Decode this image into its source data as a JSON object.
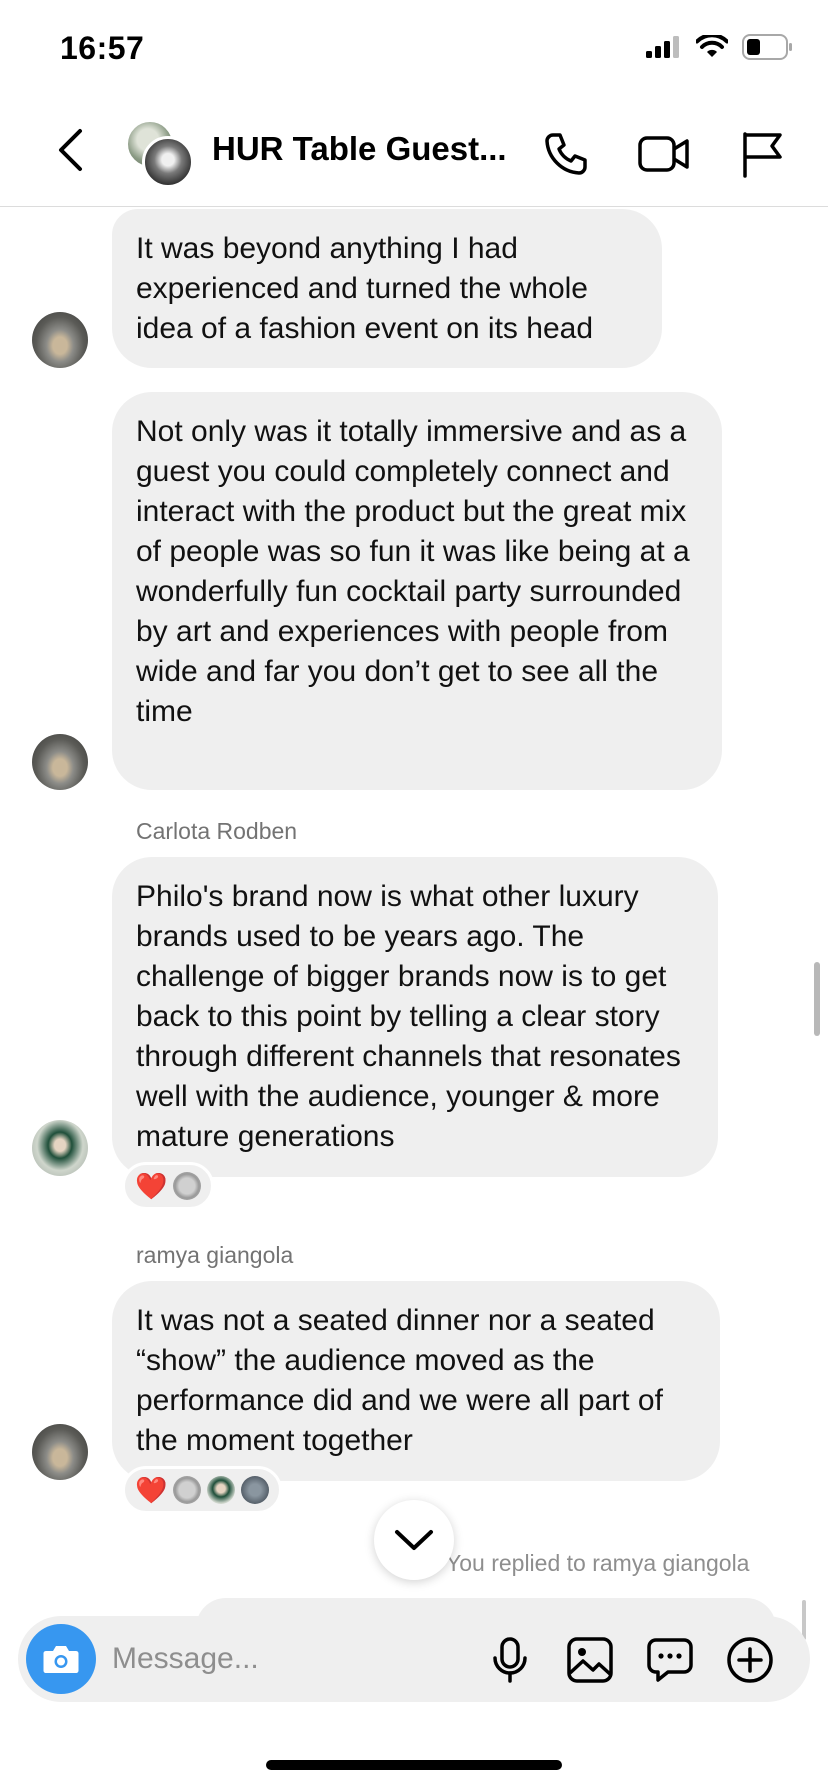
{
  "status_bar": {
    "time": "16:57"
  },
  "header": {
    "title": "HUR Table Guest..."
  },
  "messages": [
    {
      "text": "It was beyond anything I had experienced and turned the whole idea of a fashion event on its head"
    },
    {
      "text": "Not only was it totally immersive and as a guest you could completely connect and interact with the product but the great mix of people was so fun it was like being at a wonderfully fun cocktail party surrounded by art and experiences with people from wide and far you don’t get to see all the time"
    },
    {
      "sender": "Carlota Rodben",
      "text": "Philo's brand now is what other luxury brands used to be years ago. The challenge of bigger brands now is to get back to this point by telling a clear story through different channels that resonates well with the audience, younger & more mature generations",
      "reactions": [
        "❤️"
      ]
    },
    {
      "sender": "ramya giangola",
      "text": "It was not a seated dinner nor a seated “show” the audience moved as the performance did and we were all part of the moment together",
      "reactions": [
        "❤️"
      ]
    }
  ],
  "reply_note": "You replied to ramya giangola",
  "composer": {
    "placeholder": "Message..."
  },
  "colors": {
    "bubble": "#efefef",
    "accent": "#3797f0",
    "heart": "#e0245e"
  }
}
